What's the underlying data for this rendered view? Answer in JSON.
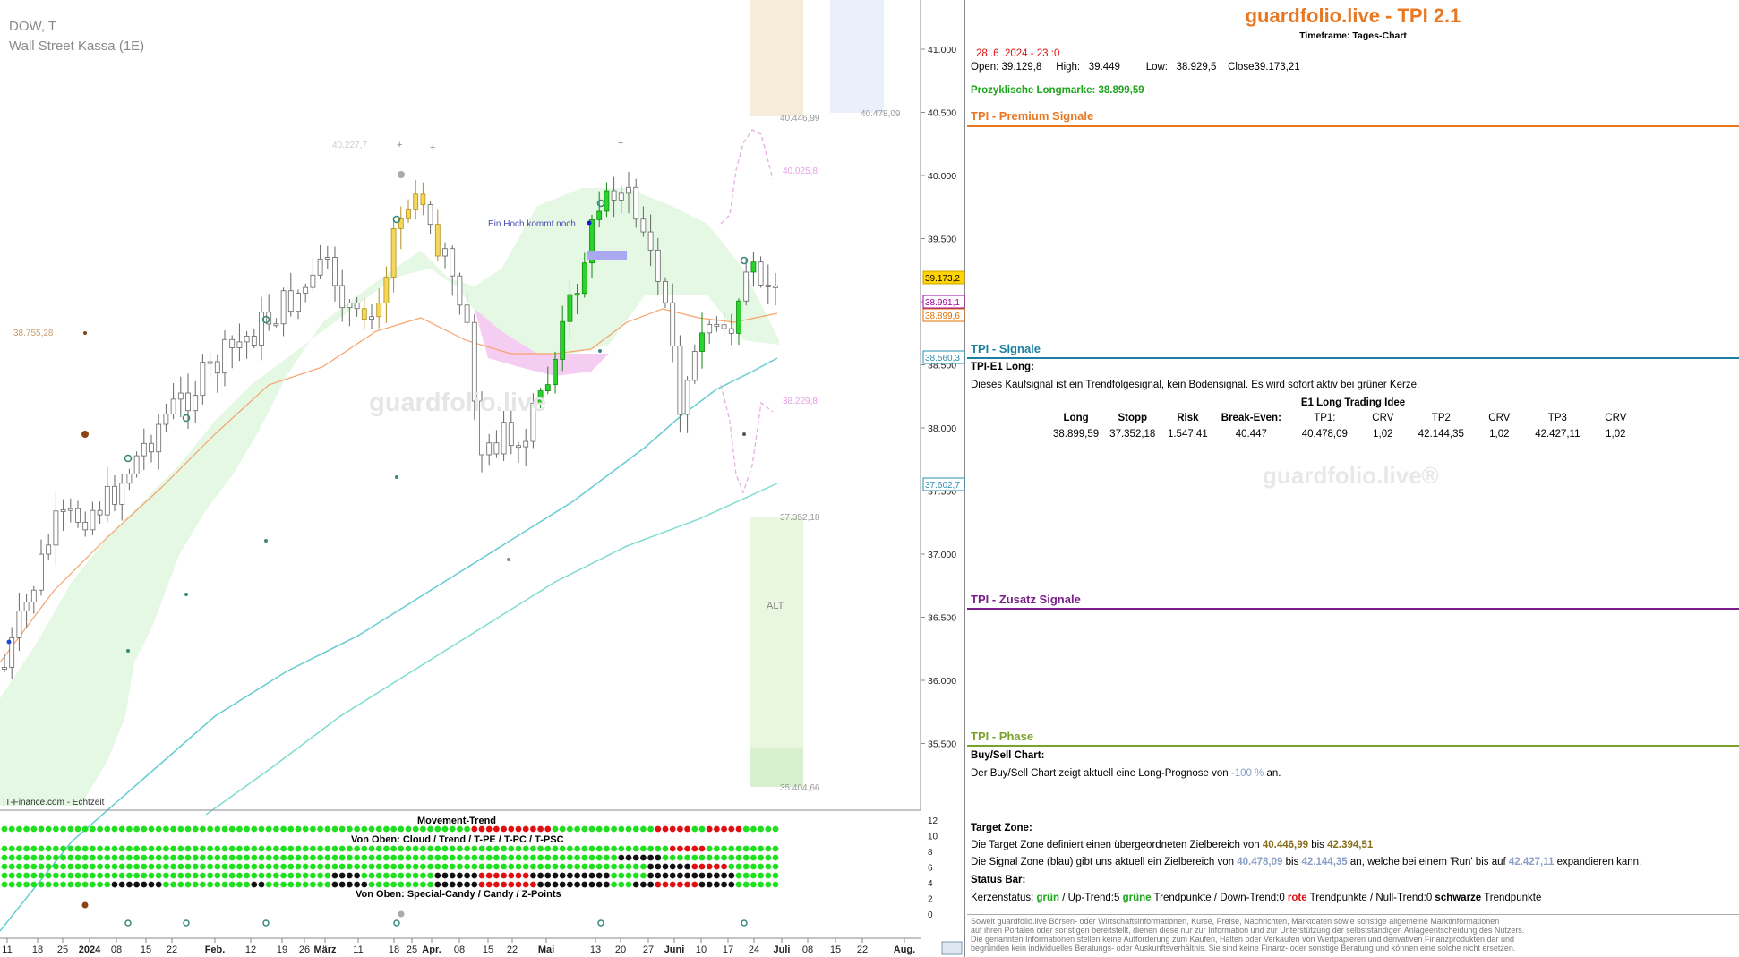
{
  "chart": {
    "symbol": "DOW, T",
    "name": "Wall Street Kassa (1E)",
    "source": "IT-Finance.com - Echtzeit",
    "watermark": "guardfolio.live",
    "annotation": "Ein Hoch kommt noch",
    "alt_label": "ALT",
    "levels": {
      "l40446": "40.446,99",
      "l40478": "40.478,09",
      "l40227": "40.227,7",
      "l40025": "40.025,8",
      "l38755": "38.755,28",
      "l38229": "38.229,8",
      "l37352": "37.352,18",
      "l35404": "35.404,66"
    },
    "y_ticks": [
      "41.000",
      "40.500",
      "40.000",
      "39.500",
      "39.000",
      "38.500",
      "38.000",
      "37.500",
      "37.000",
      "36.500",
      "36.000",
      "35.500"
    ],
    "price_tags": [
      {
        "label": "39.173,2",
        "bg": "#ffd400",
        "fg": "#000"
      },
      {
        "label": "38.991,1",
        "bg": "#fff",
        "fg": "#a000a0"
      },
      {
        "label": "38.899,6",
        "bg": "#fff",
        "fg": "#e07000"
      },
      {
        "label": "38.560,3",
        "bg": "#fff",
        "fg": "#2a8fb0"
      },
      {
        "label": "37.602,7",
        "bg": "#fff",
        "fg": "#2a8fb0"
      }
    ],
    "x_ticks": [
      "11",
      "18",
      "25",
      "2024",
      "08",
      "15",
      "22",
      "Feb.",
      "12",
      "19",
      "26",
      "März",
      "11",
      "18",
      "25",
      "Apr.",
      "08",
      "15",
      "22",
      "Mai",
      "13",
      "20",
      "27",
      "Juni",
      "10",
      "17",
      "24",
      "Juli",
      "08",
      "15",
      "22",
      "Aug."
    ],
    "indicator": {
      "movement_title": "Movement-Trend",
      "cloud_title": "Von Oben: Cloud / Trend / T-PE / T-PC / T-PSC",
      "candy_title": "Von Oben: Special-Candy / Candy / Z-Points",
      "y_ticks": [
        "12",
        "10",
        "8",
        "6",
        "4",
        "2",
        "0"
      ]
    }
  },
  "panel": {
    "title": "guardfolio.live - TPI 2.1",
    "timeframe": "Timeframe: Tages-Chart",
    "datetime": "28 .6 .2024  - 23 :0",
    "open_label": "Open:",
    "open": "39.129,8",
    "high_label": "High:",
    "high": "39.449",
    "low_label": "Low:",
    "low": "38.929,5",
    "close_label": "Close",
    "close": "39.173,21",
    "longmark": "Prozyklische Longmarke: 38.899,59",
    "premium_title": "TPI - Premium Signale",
    "signale_title": "TPI - Signale",
    "e1_title": "TPI-E1 Long:",
    "e1_desc": "Dieses Kaufsignal ist ein Trendfolgesignal, kein Bodensignal. Es wird sofort aktiv bei grüner Kerze.",
    "trade_title": "E1 Long Trading Idee",
    "trade_headers": [
      "Long",
      "Stopp",
      "Risk",
      "Break-Even:",
      "TP1:",
      "CRV",
      "TP2",
      "CRV",
      "TP3",
      "CRV"
    ],
    "trade_values": [
      "38.899,59",
      "37.352,18",
      "1.547,41",
      "40.447",
      "40.478,09",
      "1,02",
      "42.144,35",
      "1,02",
      "42.427,11",
      "1,02"
    ],
    "watermark": "guardfolio.live®",
    "zusatz_title": "TPI - Zusatz Signale",
    "phase_title": "TPI - Phase",
    "buysell_title": "Buy/Sell Chart:",
    "buysell_pre": "Der Buy/Sell Chart zeigt aktuell eine Long-Prognose von ",
    "buysell_val": "-100 %",
    "buysell_post": " an.",
    "target_title": "Target Zone:",
    "target_pre": "Die Target Zone definiert einen übergeordneten Zielbereich von ",
    "target_v1": "40.446,99",
    "target_mid": "  bis ",
    "target_v2": "42.394,51",
    "signal_pre": "Die Signal Zone (blau) gibt uns aktuell ein Zielbereich von ",
    "signal_v1": "40.478,09",
    "signal_mid": "  bis  ",
    "signal_v2": "42.144,35",
    "signal_post": " an, welche bei einem 'Run' bis auf ",
    "signal_v3": "42.427,11",
    "signal_end": "  expandieren kann.",
    "status_title": "Status Bar:",
    "status_a": "Kerzenstatus:   ",
    "status_green": "grün",
    "status_b": "     / Up-Trend:5 ",
    "status_c": "grüne",
    "status_d": " Trendpunkte   / Down-Trend:0 ",
    "status_e": "rote",
    "status_f": " Trendpunkte / Null-Trend:0 ",
    "status_g": "schwarze",
    "status_h": " Trendpunkte",
    "disclaimer": [
      "Soweit guardfolio.live Börsen- oder Wirtschaftsinformationen, Kurse, Preise, Nachrichten, Marktdaten sowie sonstige allgemeine Marktinformationen",
      "auf ihren Portalen oder sonstigen bereitstellt, dienen diese nur zur Information und zur Unterstützung der selbstständigen Anlageentscheidung des Nutzers.",
      "Die genannten Informationen stellen keine Aufforderung zum Kaufen, Halten oder Verkaufen von Wertpapieren und derivativen Finanzprodukten dar und",
      "begründen kein individuelles Beratungs- oder Auskunftsverhältnis. Sie sind keine Finanz- oder sonstige Beratung und können eine solche nicht ersetzen."
    ]
  },
  "colors": {
    "orange": "#e87722",
    "teal": "#1b7fa3",
    "purple": "#7a1f8a",
    "olive": "#7aa32a",
    "green": "#1aa51a",
    "red": "#d11",
    "blue_val": "#8aa0c8",
    "gold_val": "#8a6d1a"
  }
}
